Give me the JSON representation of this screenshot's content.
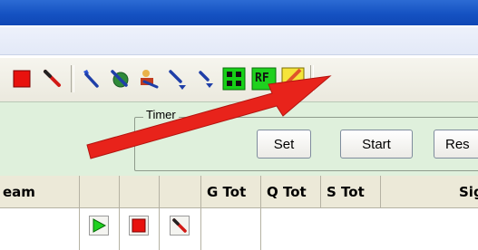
{
  "timer": {
    "group_label": "Timer",
    "set_label": "Set",
    "start_label": "Start",
    "reset_label": "Res"
  },
  "toolbar": {
    "icons": [
      "stop-icon",
      "pencil-icon",
      "wrench-icon",
      "wrench-gear-icon",
      "wrench-person-icon",
      "wrench-down-icon",
      "wrench-down-small-icon",
      "grid-icon",
      "rf-icon",
      "yellow-swatch-icon"
    ],
    "rf_label": "RF"
  },
  "grid": {
    "columns": [
      "eam",
      "",
      "",
      "",
      "G Tot",
      "Q Tot",
      "S Tot",
      "Sig"
    ]
  },
  "colors": {
    "titlebar": "#1552c2",
    "panel_green": "#dff0dc",
    "arrow_red": "#e8231b",
    "rf_green": "#1fd11f"
  }
}
